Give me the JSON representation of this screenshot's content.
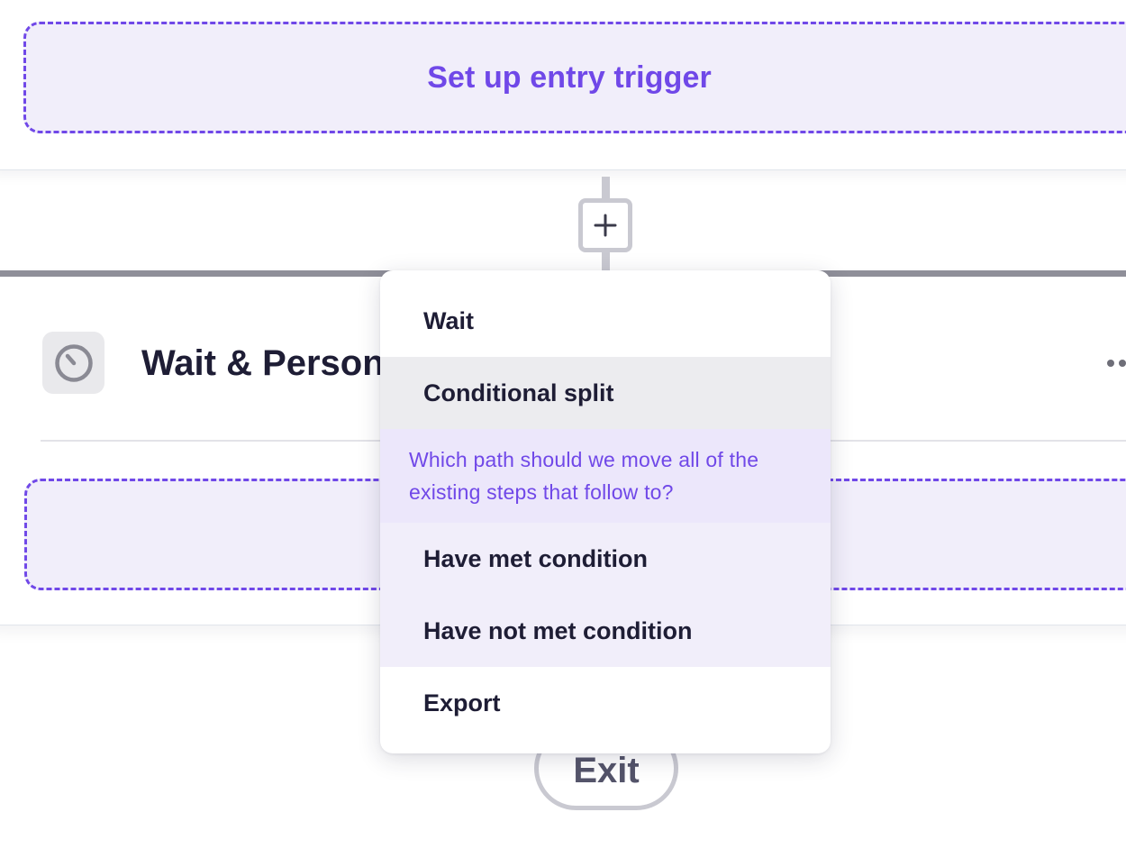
{
  "trigger": {
    "label": "Set up entry trigger"
  },
  "connector": {
    "add_icon": "plus-icon"
  },
  "step": {
    "icon": "clock-icon",
    "title": "Wait & Person",
    "more_icon": "more-horizontal-icon"
  },
  "exit": {
    "label": "Exit"
  },
  "menu": {
    "items": {
      "wait": "Wait",
      "conditional_split": "Conditional split",
      "export": "Export"
    },
    "split_prompt": "Which path should we move all of the existing steps that follow to?",
    "split_options": {
      "met": "Have met condition",
      "not_met": "Have not met condition"
    },
    "hovered_item": "Conditional split"
  },
  "colors": {
    "accent": "#7048e8",
    "dashed_zone_bg": "#f1eefa",
    "prompt_bg": "#ece7fb",
    "hover_bg": "#ececef",
    "text_dark": "#1e1d35",
    "connector": "#c9c9d1"
  }
}
